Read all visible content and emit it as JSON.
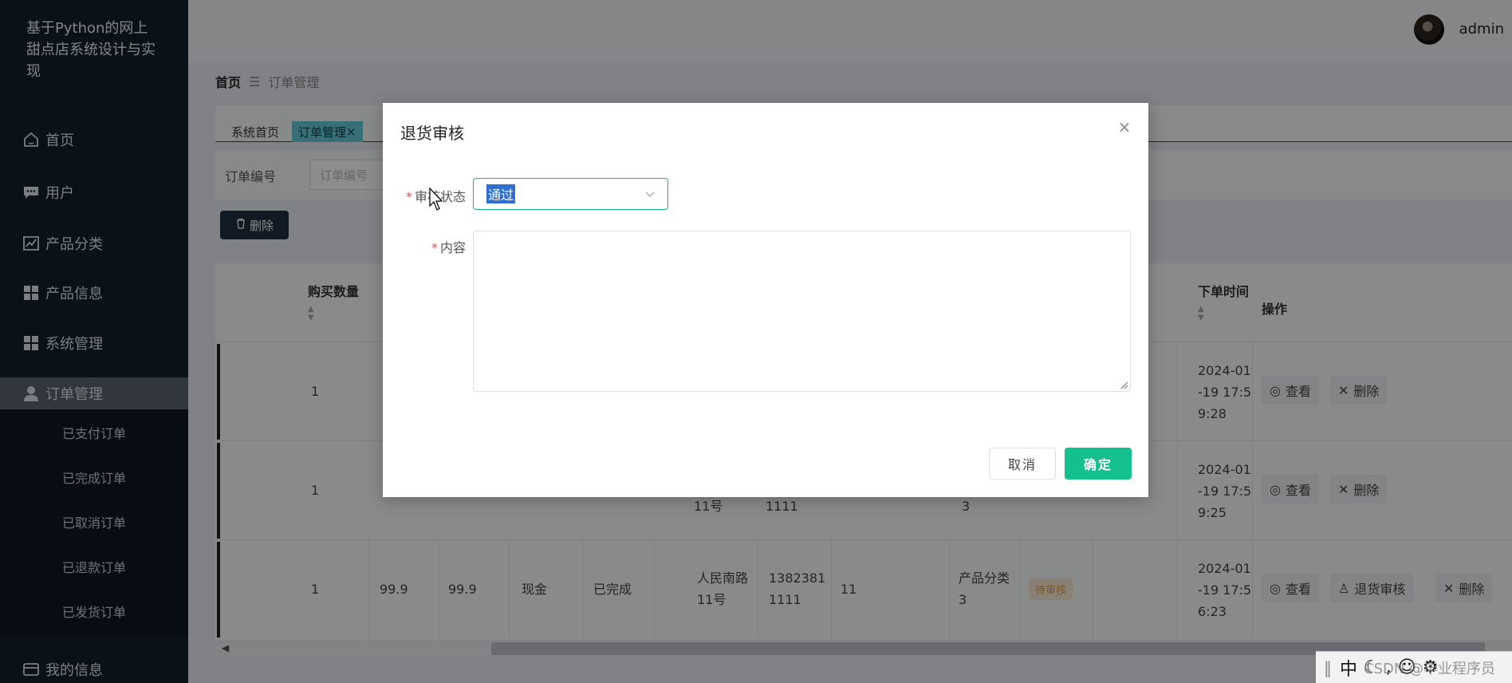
{
  "app": {
    "title": "基于Python的网上甜点店系统设计与实现"
  },
  "sidebar": {
    "items": [
      {
        "label": "首页",
        "icon": "home-icon"
      },
      {
        "label": "用户",
        "icon": "chat-icon"
      },
      {
        "label": "产品分类",
        "icon": "chart-icon"
      },
      {
        "label": "产品信息",
        "icon": "grid-icon"
      },
      {
        "label": "系统管理",
        "icon": "grid-icon"
      },
      {
        "label": "订单管理",
        "icon": "user-icon"
      }
    ],
    "sub_items": [
      "已支付订单",
      "已完成订单",
      "已取消订单",
      "已退款订单",
      "已发货订单"
    ],
    "bottom_item": {
      "label": "我的信息",
      "icon": "card-icon"
    }
  },
  "header": {
    "username": "admin"
  },
  "breadcrumb": {
    "home": "首页",
    "separator": "☰",
    "current": "订单管理"
  },
  "tabs": [
    {
      "label": "系统首页"
    },
    {
      "label": "订单管理",
      "close": "×"
    }
  ],
  "search": {
    "label": "订单编号",
    "placeholder": "订单编号"
  },
  "toolbar": {
    "delete_label": "删除"
  },
  "table": {
    "headers": {
      "quantity": "购买数量",
      "order_time": "下单时间",
      "actions": "操作"
    },
    "rows": [
      {
        "quantity": "1",
        "order_time": [
          "2024-01",
          "-19 17:5",
          "9:28"
        ]
      },
      {
        "quantity": "1",
        "address_tail": "11号",
        "phone_tail": "1111",
        "category_tail": "3",
        "order_time": [
          "2024-01",
          "-19 17:5",
          "9:25"
        ]
      },
      {
        "quantity": "1",
        "price": "99.9",
        "total": "99.9",
        "payment": "现金",
        "status": "已完成",
        "address": [
          "人民南路",
          "11号"
        ],
        "phone": [
          "1382381",
          "1111"
        ],
        "remark": "11",
        "category": [
          "产品分类",
          "3"
        ],
        "review_status": "待审核",
        "order_time": [
          "2024-01",
          "-19 17:5",
          "6:23"
        ]
      }
    ],
    "actions": {
      "view": "查看",
      "delete": "删除",
      "return_review": "退货审核"
    }
  },
  "dialog": {
    "title": "退货审核",
    "close": "×",
    "status_label": "审核状态",
    "status_value": "通过",
    "content_label": "内容",
    "content_value": "",
    "required_mark": "*",
    "cancel_label": "取消",
    "confirm_label": "确定"
  },
  "ime": {
    "mode": "中",
    "watermark": "CSDN @毕业程序员"
  },
  "colors": {
    "sidebar_bg": "#131f2b",
    "accent": "#13c08e",
    "tab_active": "#67c8d6",
    "selection": "#2f6fd1"
  }
}
